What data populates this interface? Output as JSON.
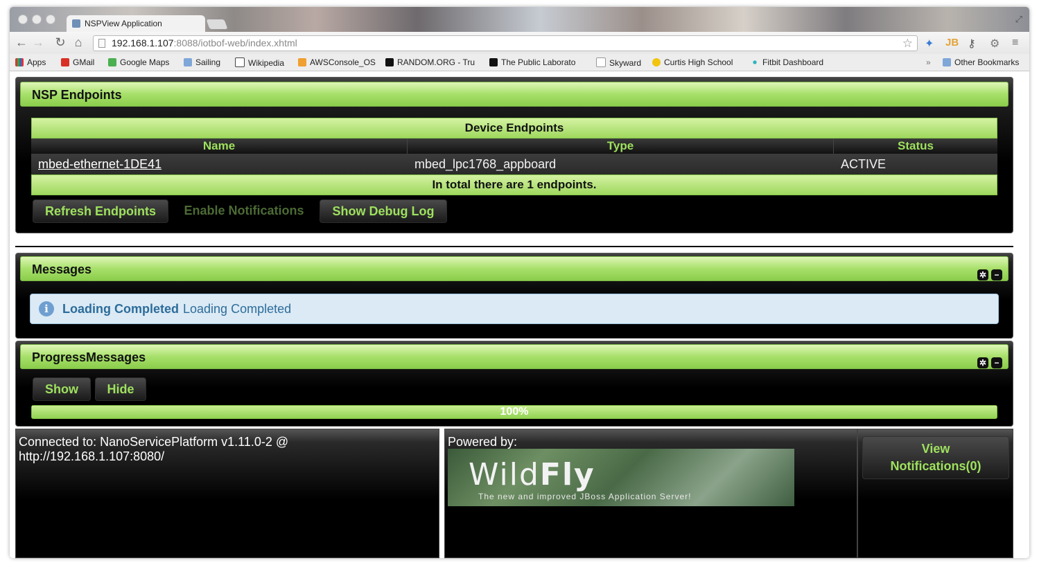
{
  "browser": {
    "tab_title": "NSPView Application",
    "url_host": "192.168.1.107",
    "url_rest": ":8088/iotbof-web/index.xhtml",
    "bookmarks": [
      "Apps",
      "GMail",
      "Google Maps",
      "Sailing",
      "Wikipedia",
      "AWSConsole_OS",
      "RANDOM.ORG - Tru",
      "The Public Laborato",
      "Skyward",
      "Curtis High School",
      "Fitbit Dashboard"
    ],
    "other_bookmarks": "Other Bookmarks",
    "ext_jb": "JB"
  },
  "endpoints": {
    "title": "NSP Endpoints",
    "table_caption": "Device Endpoints",
    "columns": [
      "Name",
      "Type",
      "Status"
    ],
    "rows": [
      {
        "name": "mbed-ethernet-1DE41",
        "type": "mbed_lpc1768_appboard",
        "status": "ACTIVE"
      }
    ],
    "footer": "In total there are 1 endpoints.",
    "buttons": {
      "refresh": "Refresh Endpoints",
      "enable": "Enable Notifications",
      "debug": "Show Debug Log"
    }
  },
  "messages": {
    "title": "Messages",
    "summary": "Loading Completed",
    "detail": "Loading Completed"
  },
  "progress": {
    "title": "ProgressMessages",
    "show": "Show",
    "hide": "Hide",
    "percent_label": "100%",
    "value": 1.0
  },
  "footer": {
    "connected_line1": "Connected to: NanoServicePlatform v1.11.0-2 @",
    "connected_line2": "http://192.168.1.107:8080/",
    "powered_by": "Powered by:",
    "logo_wild": "Wild",
    "logo_fly": "Fly",
    "logo_tagline": "The new and improved JBoss Application Server!",
    "view_line1": "View",
    "view_line2": "Notifications(0)"
  },
  "colors": {
    "accent_green": "#9ee15e",
    "header_green": "#a7e06a",
    "info_blue": "#2d6c9a"
  }
}
